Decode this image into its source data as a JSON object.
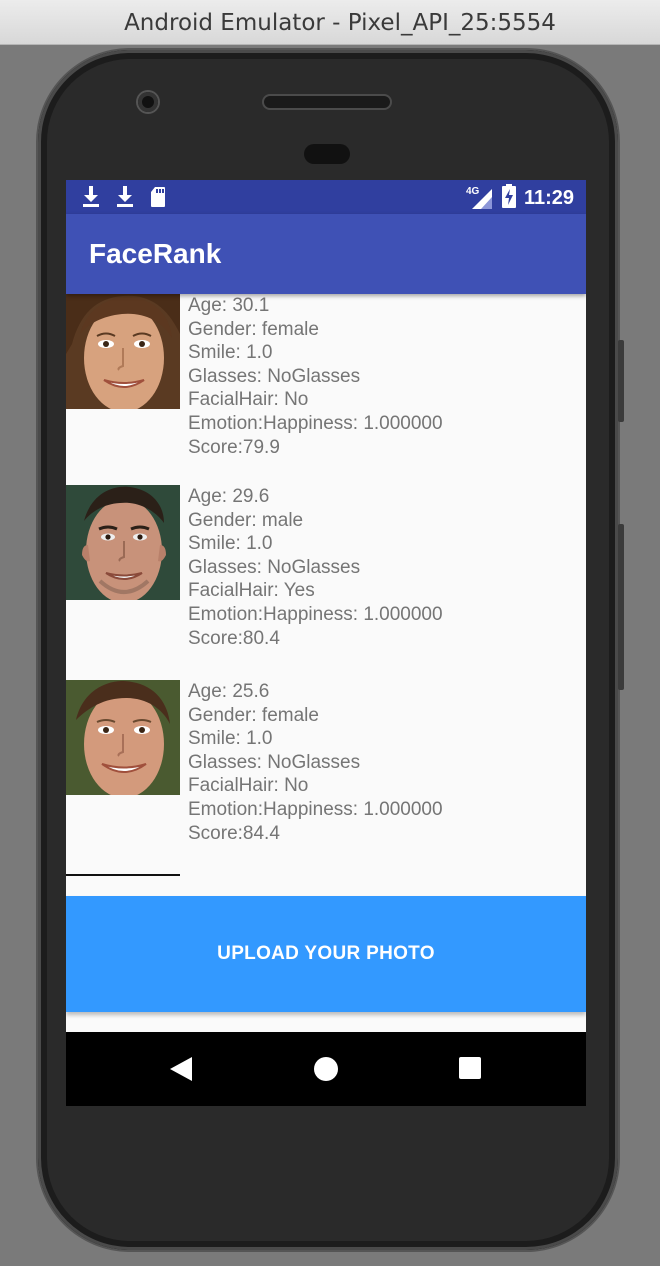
{
  "window": {
    "title": "Android Emulator - Pixel_API_25:5554"
  },
  "status_bar": {
    "network": "4G",
    "time": "11:29"
  },
  "app": {
    "title": "FaceRank"
  },
  "faces": [
    {
      "age": "Age: 30.1",
      "gender": "Gender: female",
      "smile": "Smile: 1.0",
      "glasses": "Glasses: NoGlasses",
      "facial_hair": "FacialHair: No",
      "emotion": "Emotion:Happiness: 1.000000",
      "score": "Score:79.9"
    },
    {
      "age": "Age: 29.6",
      "gender": "Gender: male",
      "smile": "Smile: 1.0",
      "glasses": "Glasses: NoGlasses",
      "facial_hair": "FacialHair: Yes",
      "emotion": "Emotion:Happiness: 1.000000",
      "score": "Score:80.4"
    },
    {
      "age": "Age: 25.6",
      "gender": "Gender: female",
      "smile": "Smile: 1.0",
      "glasses": "Glasses: NoGlasses",
      "facial_hair": "FacialHair: No",
      "emotion": "Emotion:Happiness: 1.000000",
      "score": "Score:84.4"
    }
  ],
  "upload_button": {
    "label": "UPLOAD YOUR PHOTO"
  },
  "colors": {
    "status_bar": "#303f9f",
    "app_bar": "#3f51b5",
    "button": "#3399ff",
    "info_text": "#757575"
  },
  "icons": {
    "status_left": [
      "download-icon",
      "download-icon",
      "sd-card-icon"
    ],
    "status_right": [
      "signal-icon",
      "battery-charging-icon"
    ],
    "nav": [
      "back-icon",
      "home-icon",
      "recents-icon"
    ]
  }
}
